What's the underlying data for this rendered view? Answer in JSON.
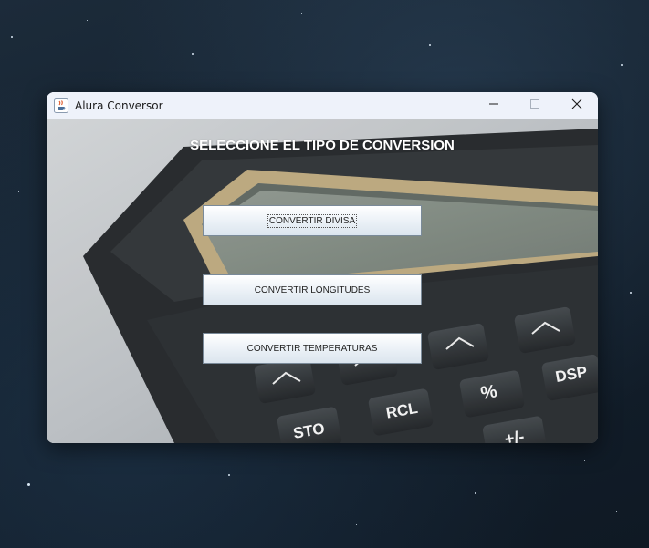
{
  "window": {
    "title": "Alura Conversor",
    "app_icon": "java-coffee-icon"
  },
  "caption_buttons": {
    "minimize_icon": "minimize-icon",
    "maximize_icon": "maximize-icon",
    "close_icon": "close-icon"
  },
  "main": {
    "heading": "SELECCIONE EL TIPO DE CONVERSION",
    "buttons": [
      {
        "label": "CONVERTIR DIVISA",
        "focused": true
      },
      {
        "label": "CONVERTIR LONGITUDES",
        "focused": false
      },
      {
        "label": "CONVERTIR TEMPERATURAS",
        "focused": false
      }
    ]
  },
  "background": {
    "image": "calculator-photo",
    "visible_keys": [
      "STO",
      "RCL",
      "%",
      "DSP",
      "+/-"
    ]
  },
  "colors": {
    "heading_text": "#ffffff",
    "titlebar": "#eef2fa",
    "button_border": "#7a8a99"
  }
}
